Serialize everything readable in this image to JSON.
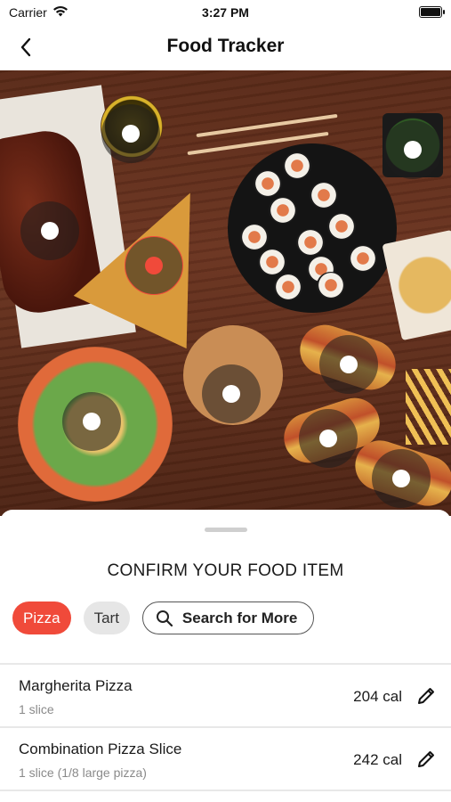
{
  "status": {
    "carrier": "Carrier",
    "time": "3:27 PM",
    "wifi_icon": "wifi-icon",
    "battery_icon": "battery-icon"
  },
  "nav": {
    "title": "Food Tracker",
    "back_icon": "chevron-left-icon"
  },
  "photo": {
    "markers": [
      {
        "name": "marker-bowl-top"
      },
      {
        "name": "marker-greens"
      },
      {
        "name": "marker-ribs"
      },
      {
        "name": "marker-pizza",
        "selected": true
      },
      {
        "name": "marker-hotdog-top"
      },
      {
        "name": "marker-salad-bowl"
      },
      {
        "name": "marker-board"
      },
      {
        "name": "marker-hotdog-middle"
      },
      {
        "name": "marker-hotdog-bottom"
      }
    ]
  },
  "sheet": {
    "title": "CONFIRM YOUR FOOD ITEM",
    "chips": [
      {
        "label": "Pizza",
        "active": true
      },
      {
        "label": "Tart",
        "active": false
      }
    ],
    "search_label": "Search for More",
    "search_icon": "search-icon",
    "items": [
      {
        "name": "Margherita Pizza",
        "serving": "1 slice",
        "calories": "204 cal",
        "edit_icon": "pencil-icon"
      },
      {
        "name": "Combination Pizza Slice",
        "serving": "1 slice (1/8 large pizza)",
        "calories": "242 cal",
        "edit_icon": "pencil-icon"
      }
    ]
  },
  "colors": {
    "accent": "#f04a3a",
    "chip_inactive": "#e6e6e6",
    "marker_overlay": "#1e1e1e"
  }
}
